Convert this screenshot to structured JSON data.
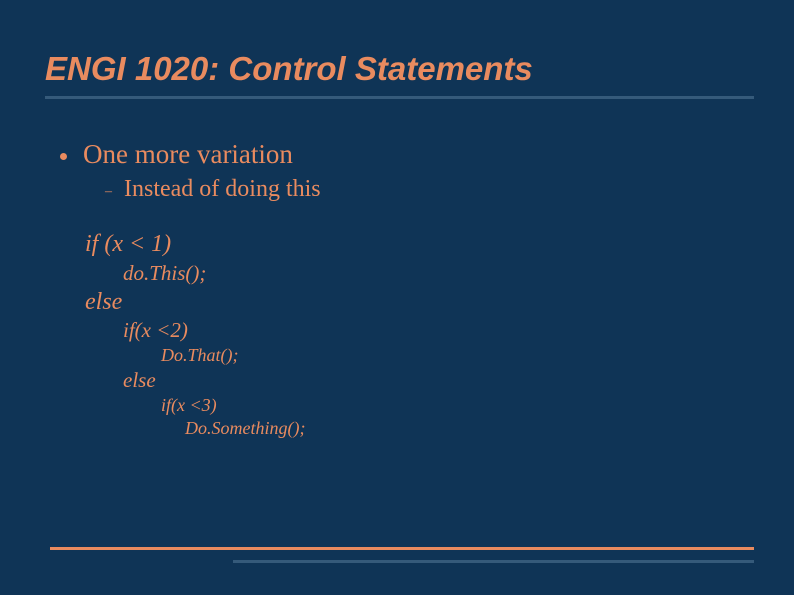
{
  "title": "ENGI 1020: Control Statements",
  "bullet1": "One more variation",
  "bullet2": "Instead of doing this",
  "code": {
    "l0": "if (x < 1)",
    "l1": "do.This();",
    "l2": "else",
    "l3": "if(x <2)",
    "l4": "Do.That();",
    "l5": "else",
    "l6": "if(x <3)",
    "l7": "Do.Something();"
  }
}
